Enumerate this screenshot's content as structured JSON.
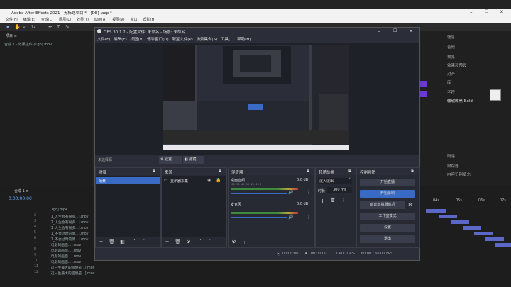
{
  "ae": {
    "title": "Adobe After Effects 2021 - 无标题项目 * - [DE] .aep *",
    "menu": [
      "文件(F)",
      "编辑(E)",
      "合成(C)",
      "图层(L)",
      "效果(T)",
      "动画(A)",
      "视图(V)",
      "窗口",
      "帮助(H)"
    ],
    "left_tab": "项目 ≡",
    "left_sub": "合成 1 - 效果控件 (1go).mov",
    "right_panel": [
      "信息",
      "音频",
      "预览",
      "效果和预设",
      "对齐",
      "库",
      "字符"
    ],
    "right_font": "微软雅黑 Bold",
    "right_labels": [
      "段落",
      "跟踪器",
      "内容识别填充"
    ],
    "timeline_tab": "合成 1 ≡",
    "timecode": "0:00:00:00",
    "layers": [
      {
        "ix": "1",
        "name": "[1go].mp4"
      },
      {
        "ix": "2",
        "name": "[1_人生会有很多...].mov"
      },
      {
        "ix": "3",
        "name": "[1_人生会有很多...].mov"
      },
      {
        "ix": "4",
        "name": "[1_人生会有很多...].mov"
      },
      {
        "ix": "5",
        "name": "[1_不会过时的情...].mov"
      },
      {
        "ix": "6",
        "name": "[1_不会过时的情...].mov"
      },
      {
        "ix": "7",
        "name": "[电影的画面...].mov"
      },
      {
        "ix": "8",
        "name": "[电影的画面...].mov"
      },
      {
        "ix": "9",
        "name": "[电影的画面...].mov"
      },
      {
        "ix": "10",
        "name": "[电影的画面...].mov"
      },
      {
        "ix": "11",
        "name": "[这一生最大的遗憾是...].mov"
      },
      {
        "ix": "12",
        "name": "[这一生最大的遗憾是...].mov"
      }
    ],
    "ruler": [
      "04s",
      "05s",
      "06s",
      "07s"
    ]
  },
  "obs": {
    "title": "OBS 30.1.2 - 配置文件: 未命名 - 场景: 未命名",
    "menu": [
      "文件(F)",
      "编辑(E)",
      "视图(V)",
      "停靠窗口(D)",
      "配置文件(P)",
      "场景集合(S)",
      "工具(T)",
      "帮助(H)"
    ],
    "scene_bar": {
      "label": "未选择源",
      "settings": "设置",
      "filters": "滤镜"
    },
    "panels": {
      "scenes": {
        "title": "场景",
        "items": [
          "场景"
        ]
      },
      "sources": {
        "title": "来源",
        "items": [
          "显示器采集"
        ]
      },
      "mixer": {
        "title": "混音器",
        "tracks": [
          {
            "name": "桌面音频",
            "db": "0.0 dB"
          },
          {
            "name": "麦克风",
            "db": "0.0 dB"
          }
        ],
        "scale": [
          "-60",
          "-55",
          "-50",
          "-45",
          "-40",
          "-35",
          "-30",
          "-25",
          "-20",
          "-15",
          "-10",
          "-5",
          "0"
        ]
      },
      "transitions": {
        "title": "转场动画",
        "type": "淡入淡出",
        "duration_label": "时长",
        "duration": "300 ms"
      },
      "controls": {
        "title": "控制按钮",
        "buttons": [
          "开始直播",
          "开始录制",
          "启动虚拟摄像机",
          "工作室模式",
          "设置",
          "退出"
        ]
      }
    },
    "status": {
      "stream_time": "00:00:00",
      "record_time": "00:00:00",
      "cpu": "CPU: 1.4%",
      "fps": "60.00 / 60.00 FPS"
    },
    "accent": "#3a6bc4"
  }
}
